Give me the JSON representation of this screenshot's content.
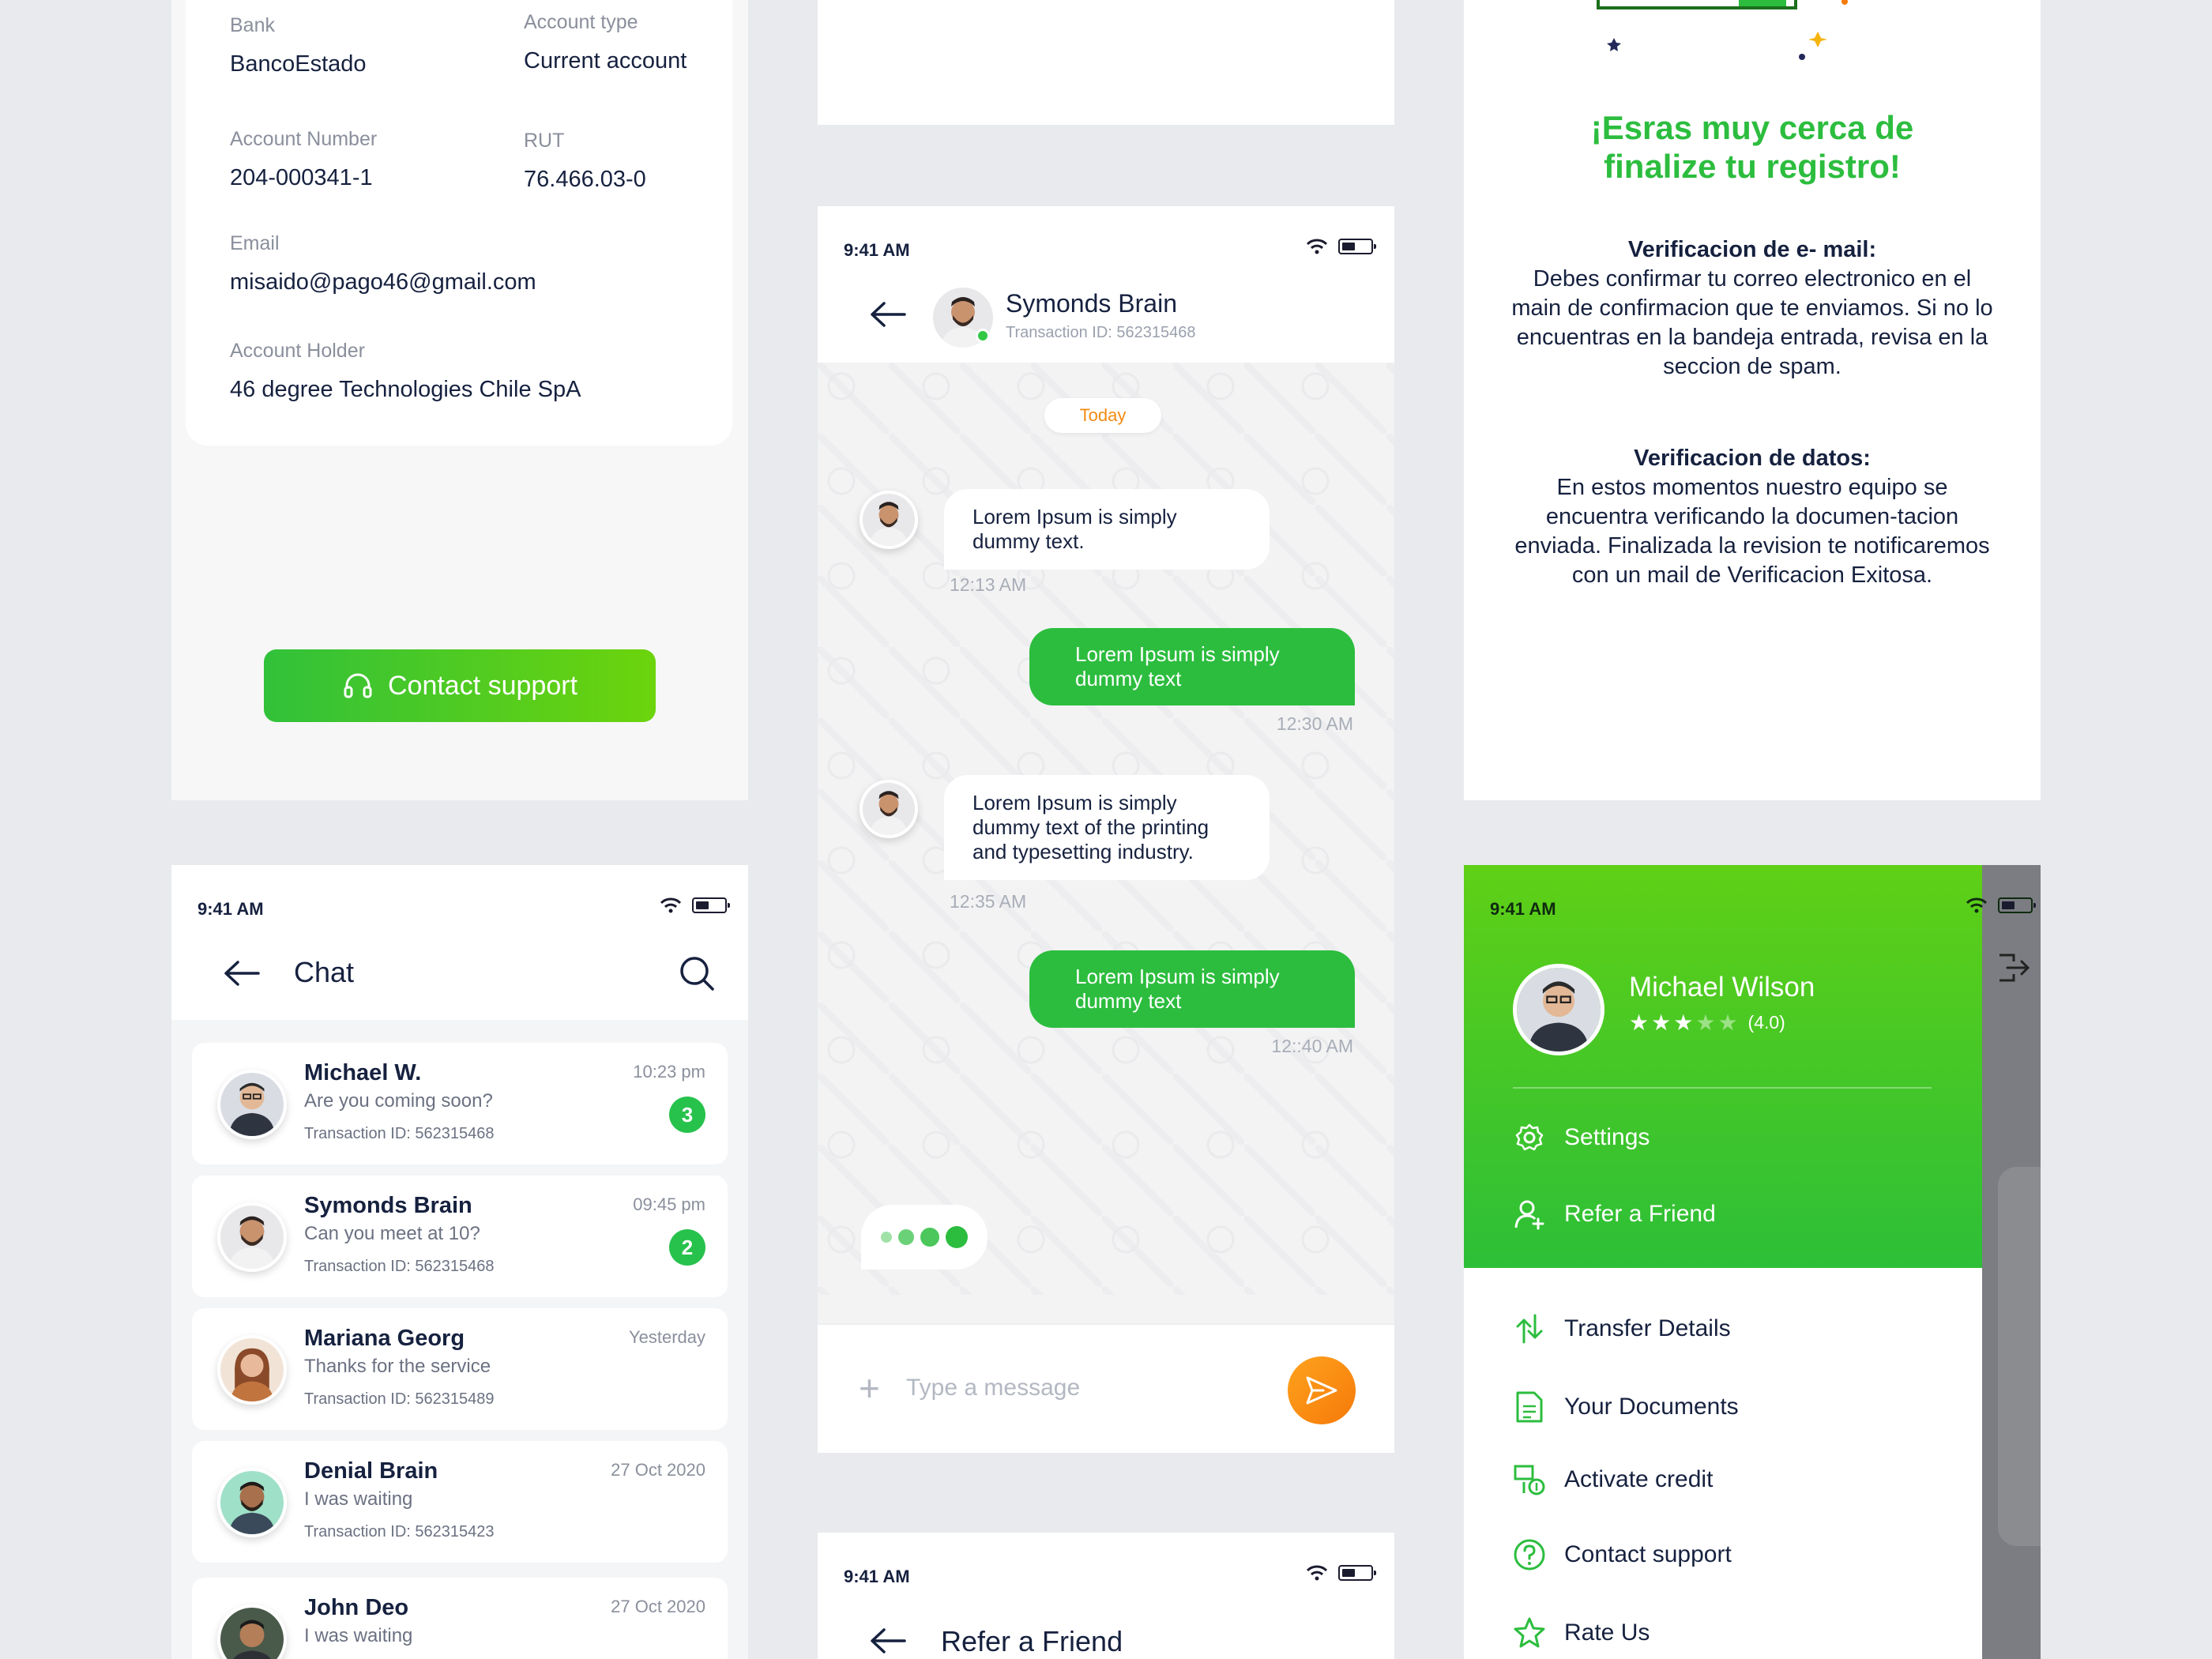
{
  "account": {
    "fields": [
      {
        "label": "Bank",
        "value": "BancoEstado"
      },
      {
        "label": "Account type",
        "value": "Current account"
      },
      {
        "label": "Account Number",
        "value": "204-000341-1"
      },
      {
        "label": "RUT",
        "value": "76.466.03-0"
      },
      {
        "label": "Email",
        "value": "misaido@pago46@gmail.com"
      },
      {
        "label": "Account Holder",
        "value": "46 degree Technologies Chile SpA"
      }
    ],
    "support_button": "Contact support"
  },
  "status_bar": {
    "time": "9:41 AM"
  },
  "chat_list": {
    "title": "Chat",
    "rows": [
      {
        "name": "Michael W.",
        "message": "Are you coming soon?",
        "transaction": "Transaction ID: 562315468",
        "when": "10:23 pm",
        "badge": "3"
      },
      {
        "name": "Symonds Brain",
        "message": "Can you meet at 10?",
        "transaction": "Transaction ID: 562315468",
        "when": "09:45 pm",
        "badge": "2"
      },
      {
        "name": "Mariana Georg",
        "message": "Thanks for the service",
        "transaction": "Transaction ID: 562315489",
        "when": "Yesterday",
        "badge": ""
      },
      {
        "name": "Denial Brain",
        "message": "I was waiting",
        "transaction": "Transaction ID: 562315423",
        "when": "27 Oct 2020",
        "badge": ""
      },
      {
        "name": "John Deo",
        "message": "I was waiting",
        "transaction": "",
        "when": "27 Oct 2020",
        "badge": ""
      }
    ]
  },
  "conversation": {
    "contact_name": "Symonds Brain",
    "transaction": "Transaction ID: 562315468",
    "day_label": "Today",
    "messages": [
      {
        "dir": "in",
        "text": "Lorem Ipsum is simply dummy text.",
        "time": "12:13 AM"
      },
      {
        "dir": "out",
        "text": "Lorem Ipsum is simply dummy text",
        "time": "12:30 AM"
      },
      {
        "dir": "in",
        "text": "Lorem Ipsum is simply dummy text of the printing and typesetting industry.",
        "time": "12:35 AM"
      },
      {
        "dir": "out",
        "text": "Lorem Ipsum is simply dummy text",
        "time": "12::40 AM"
      }
    ],
    "composer_placeholder": "Type a message"
  },
  "refer": {
    "title": "Refer a Friend"
  },
  "registration": {
    "heading_line1": "¡Esras muy cerca de",
    "heading_line2": "finalize tu registro!",
    "email_title": "Verificacion de e- mail:",
    "email_text": "Debes confirmar tu correo electronico en el main de confirmacion que te enviamos. Si no lo encuentras en la bandeja entrada, revisa en la seccion de spam.",
    "data_title": "Verificacion de datos:",
    "data_text": "En estos momentos nuestro equipo se encuentra verificando la documen-tacion enviada. Finalizada la revision te notificaremos con un mail de Verificacion Exitosa."
  },
  "drawer": {
    "user_name": "Michael Wilson",
    "rating": 3,
    "rating_label": "(4.0)",
    "items_top": [
      {
        "icon": "gear-icon",
        "label": "Settings"
      },
      {
        "icon": "user-plus-icon",
        "label": "Refer a Friend"
      }
    ],
    "items": [
      {
        "icon": "transfer-icon",
        "label": "Transfer Details"
      },
      {
        "icon": "document-icon",
        "label": "Your Documents"
      },
      {
        "icon": "credit-icon",
        "label": "Activate credit"
      },
      {
        "icon": "help-icon",
        "label": "Contact support"
      },
      {
        "icon": "star-icon",
        "label": "Rate Us"
      }
    ]
  },
  "colors": {
    "primary_green": "#2cbd3e",
    "accent_orange": "#f57a0a",
    "navy": "#16213f"
  }
}
